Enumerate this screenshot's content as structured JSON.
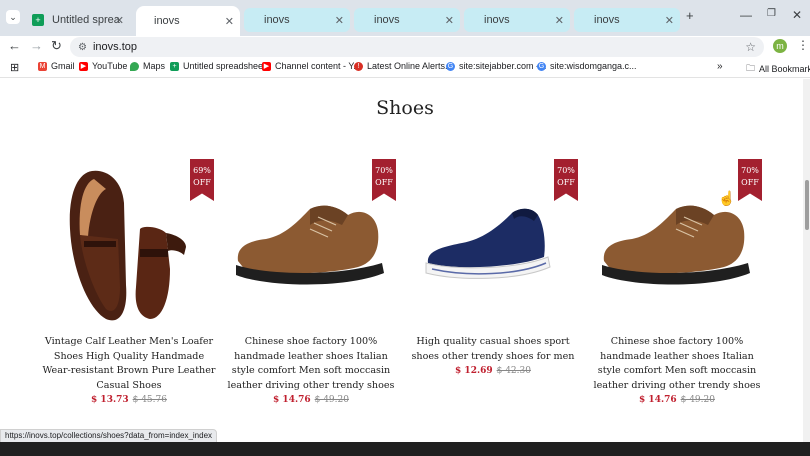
{
  "browser": {
    "tabs": [
      {
        "label": "Untitled spreadsheet",
        "icon": "sheets-icon"
      },
      {
        "label": "inovs",
        "icon": ""
      },
      {
        "label": "inovs",
        "icon": ""
      },
      {
        "label": "inovs",
        "icon": ""
      },
      {
        "label": "inovs",
        "icon": ""
      },
      {
        "label": "inovs",
        "icon": ""
      }
    ],
    "new_tab": "+",
    "url": "inovs.top",
    "avatar_letter": "m",
    "bookmarks": [
      {
        "label": "Gmail",
        "icon": "gmail-icon",
        "color": "#ea4335"
      },
      {
        "label": "YouTube",
        "icon": "youtube-icon",
        "color": "#ff0000"
      },
      {
        "label": "Maps",
        "icon": "maps-icon",
        "color": "#34a853"
      },
      {
        "label": "Untitled spreadshee...",
        "icon": "sheets-icon",
        "color": "#0f9d58"
      },
      {
        "label": "Channel content - Y...",
        "icon": "youtube-icon",
        "color": "#ff0000"
      },
      {
        "label": "Latest Online Alerts...",
        "icon": "alert-icon",
        "color": "#d93025"
      },
      {
        "label": "site:sitejabber.com -...",
        "icon": "google-icon",
        "color": "#4285f4"
      },
      {
        "label": "site:wisdomganga.c...",
        "icon": "google-icon",
        "color": "#4285f4"
      }
    ],
    "all_bookmarks": "All Bookmarks",
    "status_url": "https://inovs.top/collections/shoes?data_from=index_index"
  },
  "page": {
    "heading": "Shoes",
    "products": [
      {
        "badge_pct": "69%",
        "badge_off": "OFF",
        "title": "Vintage Calf Leather Men's Loafer Shoes High Quality Handmade Wear-resistant Brown Pure Leather Casual Shoes",
        "price": "$ 13.73",
        "old_price": "$ 45.76",
        "image": "brown-loafers"
      },
      {
        "badge_pct": "70%",
        "badge_off": "OFF",
        "title": "Chinese shoe factory 100% handmade leather shoes Italian style comfort Men soft moccasin leather driving other trendy shoes",
        "price": "$ 14.76",
        "old_price": "$ 49.20",
        "image": "suede-derby"
      },
      {
        "badge_pct": "70%",
        "badge_off": "OFF",
        "title": "High quality casual shoes sport shoes other trendy shoes for men",
        "price": "$ 12.69",
        "old_price": "$ 42.30",
        "image": "navy-slip-on"
      },
      {
        "badge_pct": "70%",
        "badge_off": "OFF",
        "title": "Chinese shoe factory 100% handmade leather shoes Italian style comfort Men soft moccasin leather driving other trendy shoes",
        "price": "$ 14.76",
        "old_price": "$ 49.20",
        "image": "suede-derby"
      }
    ]
  },
  "colors": {
    "accent": "#a3202f",
    "price": "#c0202f"
  }
}
